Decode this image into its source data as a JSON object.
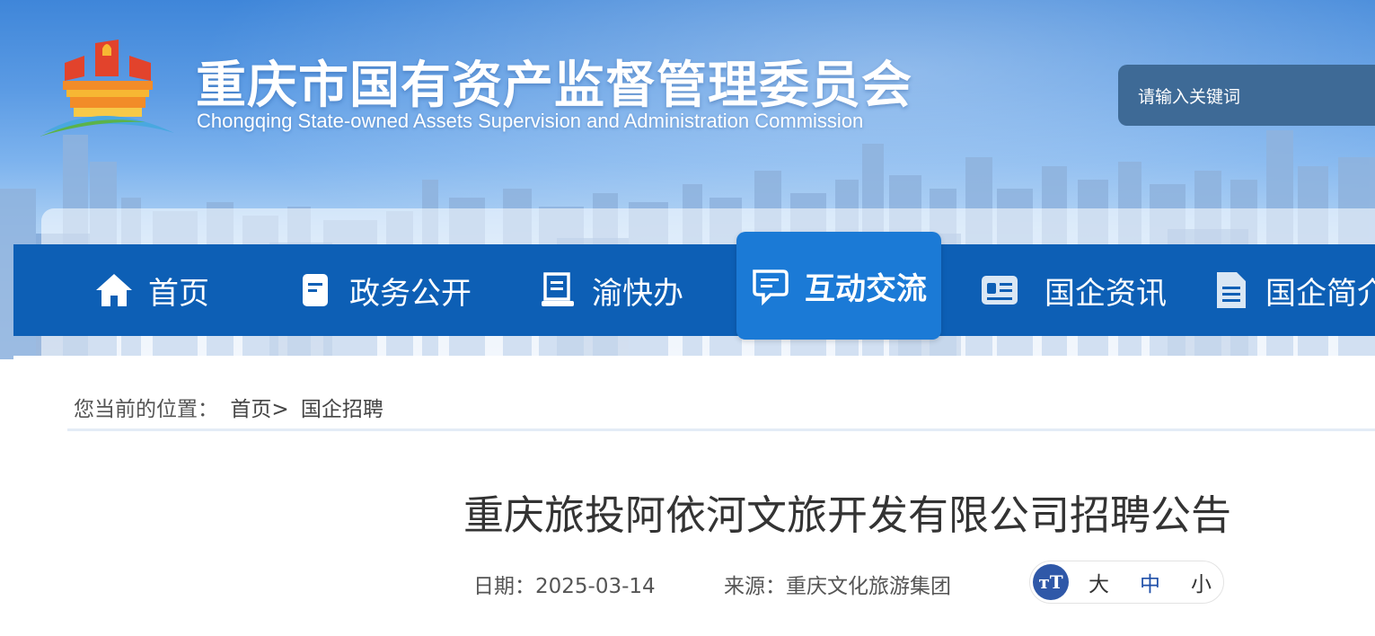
{
  "header": {
    "title": "重庆市国有资产监督管理委员会",
    "subtitle": "Chongqing State-owned Assets Supervision and Administration Commission",
    "search_placeholder": "请输入关键词"
  },
  "nav": {
    "items": [
      {
        "label": "首页",
        "icon": "home-icon"
      },
      {
        "label": "政务公开",
        "icon": "document-icon"
      },
      {
        "label": "渝快办",
        "icon": "service-desk-icon"
      },
      {
        "label": "互动交流",
        "icon": "chat-icon",
        "active": true
      },
      {
        "label": "国企资讯",
        "icon": "news-card-icon"
      },
      {
        "label": "国企简介",
        "icon": "file-list-icon"
      }
    ]
  },
  "breadcrumb": {
    "prefix": "您当前的位置：",
    "home": "首页>",
    "current": "国企招聘"
  },
  "article": {
    "title": "重庆旅投阿依河文旅开发有限公司招聘公告",
    "date_label": "日期：2025-03-14",
    "source_label": "来源：重庆文化旅游集团"
  },
  "font_size": {
    "icon": "font-size-icon",
    "large": "大",
    "medium": "中",
    "small": "小",
    "selected": "中"
  },
  "colors": {
    "nav_bg": "#0d5fb5",
    "nav_active": "#1b7ad6",
    "search_bg": "#3e6a96",
    "accent": "#2f58a8"
  }
}
